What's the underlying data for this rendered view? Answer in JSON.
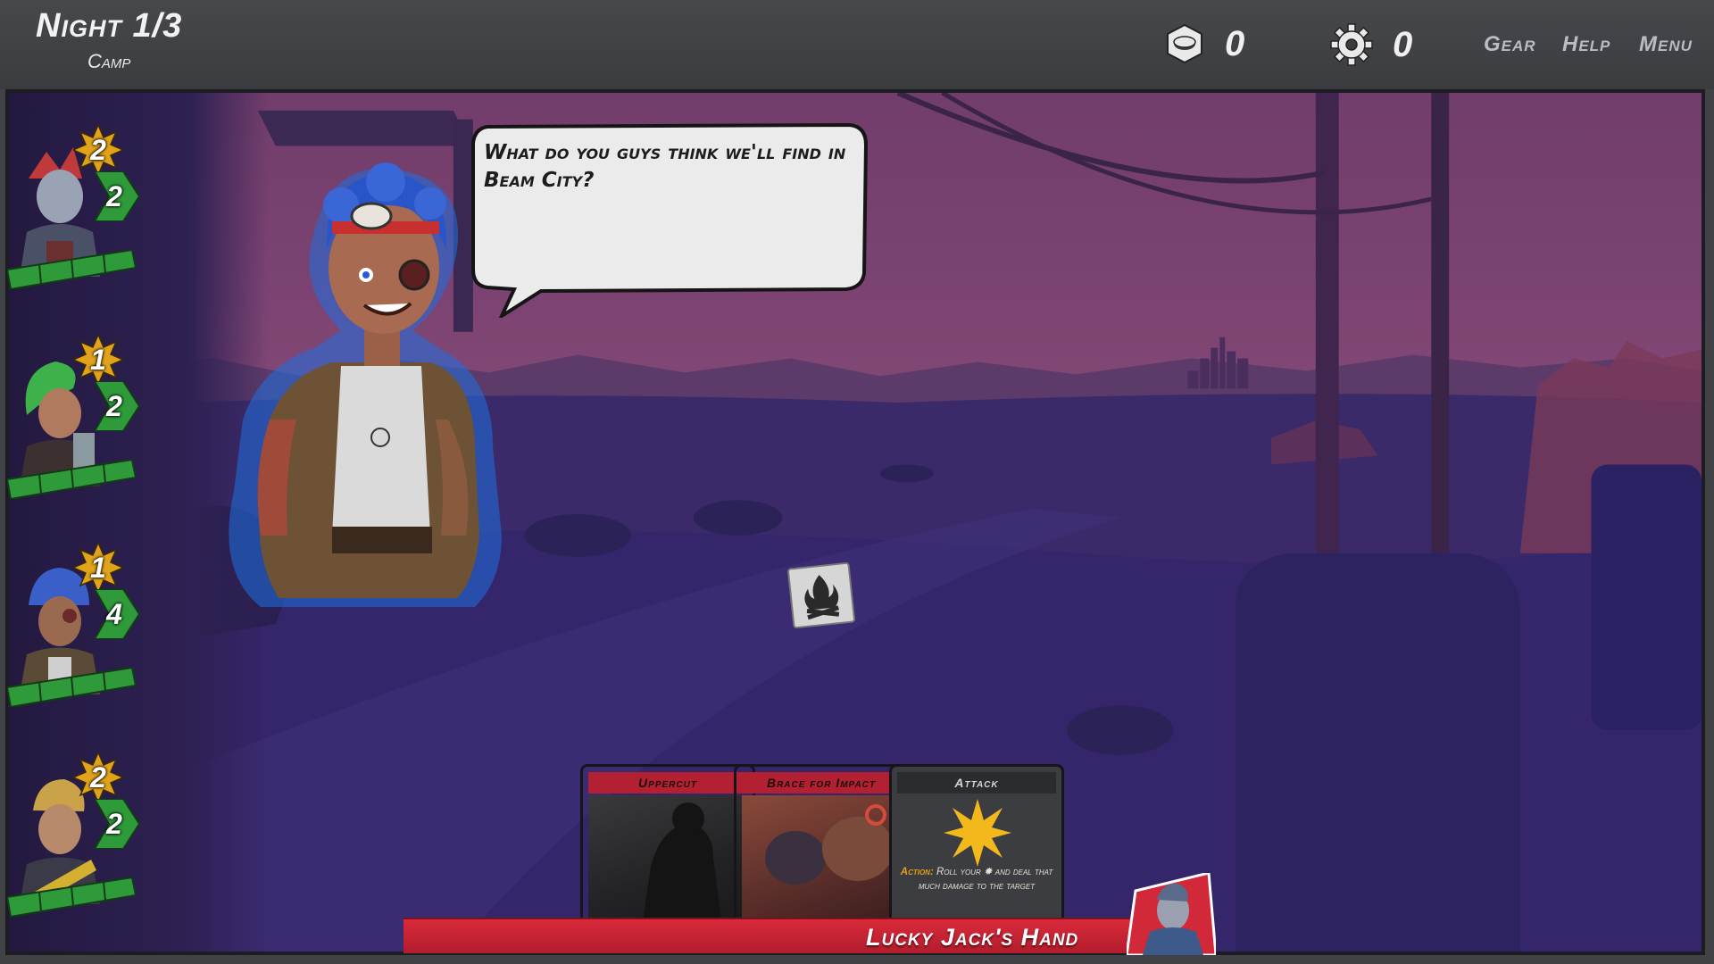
{
  "header": {
    "night_label": "Night 1/3",
    "location_label": "Camp",
    "resources": [
      {
        "icon": "hex-nut-icon",
        "value": "0"
      },
      {
        "icon": "gear-icon",
        "value": "0"
      }
    ],
    "links": [
      "Gear",
      "Help",
      "Menu"
    ]
  },
  "party": [
    {
      "name": "red-haired-fighter",
      "level": "2",
      "health": "2",
      "hair_color": "#c0393b"
    },
    {
      "name": "green-haired-brawler",
      "level": "1",
      "health": "2",
      "hair_color": "#3db24a"
    },
    {
      "name": "goggled-mechanic",
      "level": "1",
      "health": "4",
      "hair_color": "#3a5fc8"
    },
    {
      "name": "lucky-jack",
      "level": "2",
      "health": "2",
      "hair_color": "#c9a24a"
    }
  ],
  "dialogue": {
    "text": "What do you guys think we'll find in Beam City?"
  },
  "camp_marker": {
    "icon": "campfire-icon"
  },
  "hand": {
    "label": "Lucky Jack's Hand",
    "cards": [
      {
        "title": "Uppercut",
        "style": "red"
      },
      {
        "title": "Brace for Impact",
        "style": "red"
      },
      {
        "title": "Attack",
        "style": "grey",
        "action_keyword": "Action:",
        "action_text": "Roll your ✹ and deal that much damage to the target"
      }
    ]
  },
  "colors": {
    "health_green": "#2f9a3a",
    "badge_gold": "#e2a31c",
    "hand_red": "#d1283a",
    "glow_blue": "#2a7ce6"
  }
}
